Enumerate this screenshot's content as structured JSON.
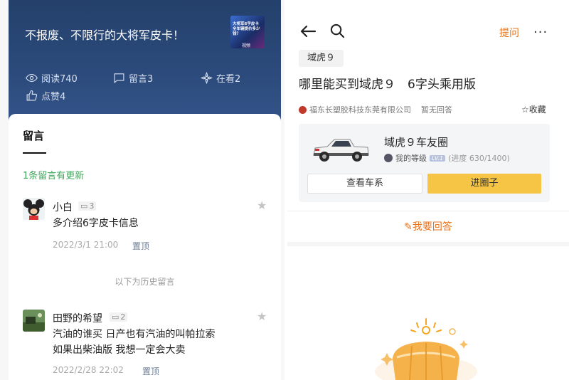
{
  "left": {
    "hero_title": "不报废、不限行的大将军皮卡！",
    "thumb_text": "大将军6字皮卡全车辆提价多少钱？",
    "thumb_tag": "视频",
    "stats": {
      "reads": "阅读740",
      "comments": "留言3",
      "watching": "在看2",
      "likes": "点赞4"
    },
    "section_title": "留言",
    "update_tip": "1条留言有更新",
    "history_label": "以下为历史留言",
    "comments": [
      {
        "name": "小白",
        "reply_count": "3",
        "text": "多介绍6字皮卡信息",
        "time": "2022/3/1 21:00",
        "pin": "置顶"
      },
      {
        "name": "田野的希望",
        "reply_count": "2",
        "text_line1": "汽油的谁买 日产也有汽油的叫帕拉索",
        "text_line2": "如果出柴油版 我想一定会大卖",
        "time": "2022/2/28 22:02",
        "pin": "置顶"
      }
    ]
  },
  "right": {
    "ask_label": "提问",
    "more_label": "···",
    "chip": "域虎９",
    "question": "哪里能买到域虎９　6字头乘用版",
    "company": "福东长塑胶科技东莞有限公司",
    "no_answer": "暂无回答",
    "favorite": "收藏",
    "club": {
      "name": "域虎９车友圈",
      "level_label": "我的等级",
      "level_badge": "LV.1",
      "progress": "(进度 630/1400)",
      "series_button": "查看车系",
      "join_button": "进圈子"
    },
    "answer_button": "我要回答"
  },
  "colors": {
    "accent_orange": "#e8731c",
    "green": "#3ea65a",
    "hero_blue": "#2c4b7c",
    "join_yellow": "#f6c545"
  }
}
